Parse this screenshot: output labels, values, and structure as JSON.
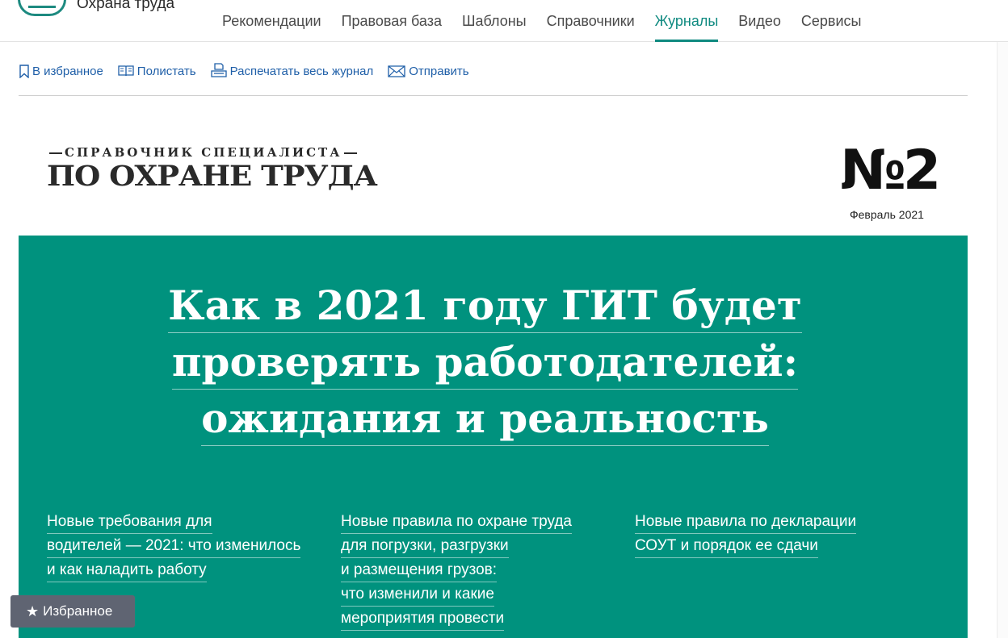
{
  "header": {
    "logo_text": "Охрана труда",
    "nav": [
      {
        "label": "Рекомендации"
      },
      {
        "label": "Правовая база"
      },
      {
        "label": "Шаблоны"
      },
      {
        "label": "Справочники"
      },
      {
        "label": "Журналы",
        "active": true
      },
      {
        "label": "Видео"
      },
      {
        "label": "Сервисы"
      }
    ]
  },
  "toolbar": {
    "favorite_label": "В избранное",
    "browse_label": "Полистать",
    "print_label": "Распечатать весь журнал",
    "send_label": "Отправить"
  },
  "magazine": {
    "subtitle": "СПРАВОЧНИК СПЕЦИАЛИСТА",
    "title": "ПО ОХРАНЕ ТРУДА",
    "issue_number": "№2",
    "issue_date": "Февраль 2021"
  },
  "cover": {
    "headline_lines": [
      "Как в 2021 году ГИТ будет",
      "проверять работодателей:",
      "ожидания и реальность"
    ],
    "articles": [
      {
        "lines": [
          "Новые требования для",
          "водителей — 2021: что изменилось",
          "и как наладить работу"
        ]
      },
      {
        "lines": [
          "Новые правила по охране труда",
          "для погрузки, разгрузки",
          "и размещения грузов:",
          "что изменили и какие",
          "мероприятия провести"
        ]
      },
      {
        "lines": [
          "Новые правила по декларации",
          "СОУТ и порядок ее сдачи"
        ]
      }
    ]
  },
  "floating": {
    "favorites_label": "Избранное"
  },
  "colors": {
    "accent": "#0f8a80",
    "cover_green": "#00927e",
    "link_blue": "#1f5fa8",
    "fav_button": "#5f6472"
  }
}
